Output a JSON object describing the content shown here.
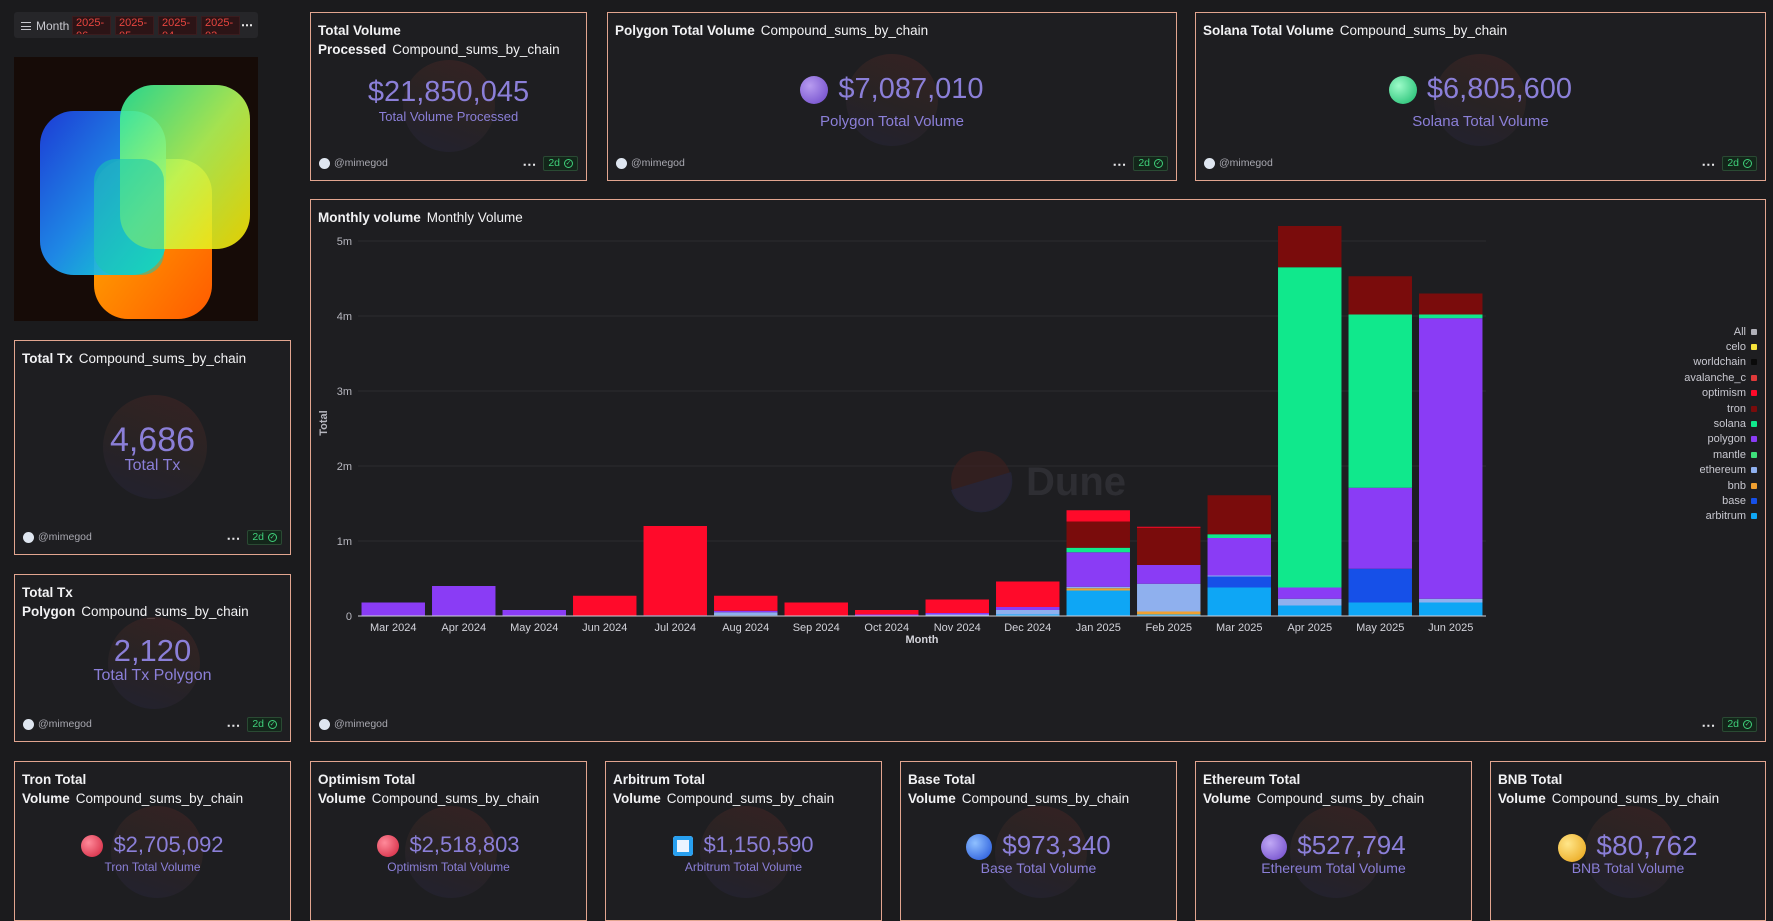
{
  "filters": {
    "label": "Month",
    "chips": [
      "2025-06",
      "2025-05",
      "2025-04",
      "2025-03"
    ],
    "more": "⋯"
  },
  "common": {
    "author": "@mimegod",
    "age": "2d",
    "dots": "⋯"
  },
  "cards": {
    "total_volume": {
      "title": "Total Volume Processed",
      "query": "Compound_sums_by_chain",
      "value": "$21,850,045",
      "label": "Total Volume Processed"
    },
    "polygon_total": {
      "title": "Polygon Total Volume",
      "query": "Compound_sums_by_chain",
      "value": "$7,087,010",
      "label": "Polygon Total Volume",
      "coin_color": "#8a6ad6"
    },
    "solana_total": {
      "title": "Solana Total Volume",
      "query": "Compound_sums_by_chain",
      "value": "$6,805,600",
      "label": "Solana Total Volume",
      "coin_color": "#29d98a"
    },
    "total_tx": {
      "title": "Total Tx",
      "query": "Compound_sums_by_chain",
      "value": "4,686",
      "label": "Total Tx"
    },
    "total_tx_polygon": {
      "title": "Total Tx Polygon",
      "query": "Compound_sums_by_chain",
      "value": "2,120",
      "label": "Total Tx Polygon"
    },
    "tron_total": {
      "title": "Tron Total Volume",
      "query": "Compound_sums_by_chain",
      "value": "$2,705,092",
      "label": "Tron Total Volume",
      "coin_color": "#e8364c"
    },
    "optimism_total": {
      "title": "Optimism Total Volume",
      "query": "Compound_sums_by_chain",
      "value": "$2,518,803",
      "label": "Optimism Total Volume",
      "coin_color": "#e8364c"
    },
    "arbitrum_total": {
      "title": "Arbitrum Total Volume",
      "query": "Compound_sums_by_chain",
      "value": "$1,150,590",
      "label": "Arbitrum Total Volume",
      "coin_color": "#28a0f0"
    },
    "base_total": {
      "title": "Base Total Volume",
      "query": "Compound_sums_by_chain",
      "value": "$973,340",
      "label": "Base Total Volume",
      "coin_color": "#2a6df4"
    },
    "ethereum_total": {
      "title": "Ethereum Total Volume",
      "query": "Compound_sums_by_chain",
      "value": "$527,794",
      "label": "Ethereum Total Volume",
      "coin_color": "#8a6ad6"
    },
    "bnb_total": {
      "title": "BNB Total Volume",
      "query": "Compound_sums_by_chain",
      "value": "$80,762",
      "label": "BNB Total Volume",
      "coin_color": "#f3ba2f"
    }
  },
  "monthly": {
    "title": "Monthly volume",
    "query": "Monthly Volume",
    "watermark": "Dune"
  },
  "chart_data": {
    "type": "bar",
    "stacked": true,
    "title": "Monthly volume",
    "xlabel": "Month",
    "ylabel": "Total",
    "ylim": [
      0,
      5000000
    ],
    "yticks": [
      "0",
      "1m",
      "2m",
      "3m",
      "4m",
      "5m"
    ],
    "legend_position": "right",
    "legend_entries": [
      "All",
      "celo",
      "worldchain",
      "avalanche_c",
      "optimism",
      "tron",
      "solana",
      "polygon",
      "mantle",
      "ethereum",
      "bnb",
      "base",
      "arbitrum"
    ],
    "legend_colors": [
      "#b0b0b8",
      "#f5e23a",
      "#0a0a0a",
      "#e03a3a",
      "#ff0a2a",
      "#7a0c0c",
      "#10e88c",
      "#8a3cf5",
      "#3ee07a",
      "#8fb0ee",
      "#f0a030",
      "#1650e8",
      "#0ea6f5"
    ],
    "categories": [
      "Mar 2024",
      "Apr 2024",
      "May 2024",
      "Jun 2024",
      "Jul 2024",
      "Aug 2024",
      "Sep 2024",
      "Oct 2024",
      "Nov 2024",
      "Dec 2024",
      "Jan 2025",
      "Feb 2025",
      "Mar 2025",
      "Apr 2025",
      "May 2025",
      "Jun 2025"
    ],
    "series": [
      {
        "name": "arbitrum",
        "color": "#0ea6f5",
        "values": [
          0,
          0,
          0,
          0,
          0,
          10000,
          0,
          0,
          10000,
          20000,
          340000,
          20000,
          380000,
          140000,
          180000,
          180000
        ]
      },
      {
        "name": "base",
        "color": "#1650e8",
        "values": [
          0,
          0,
          0,
          0,
          0,
          0,
          0,
          0,
          0,
          0,
          0,
          0,
          150000,
          0,
          450000,
          0
        ]
      },
      {
        "name": "bnb",
        "color": "#f0a030",
        "values": [
          0,
          0,
          0,
          0,
          0,
          0,
          0,
          0,
          0,
          0,
          30000,
          40000,
          0,
          0,
          0,
          0
        ]
      },
      {
        "name": "ethereum",
        "color": "#8fb0ee",
        "values": [
          0,
          0,
          0,
          0,
          0,
          40000,
          0,
          10000,
          10000,
          60000,
          20000,
          370000,
          10000,
          90000,
          0,
          50000
        ]
      },
      {
        "name": "mantle",
        "color": "#3ee07a",
        "values": [
          0,
          0,
          0,
          0,
          0,
          0,
          0,
          0,
          0,
          0,
          0,
          0,
          0,
          0,
          0,
          0
        ]
      },
      {
        "name": "polygon",
        "color": "#8a3cf5",
        "values": [
          180000,
          400000,
          80000,
          0,
          10000,
          20000,
          0,
          10000,
          20000,
          40000,
          460000,
          250000,
          500000,
          150000,
          1080000,
          3740000
        ]
      },
      {
        "name": "solana",
        "color": "#10e88c",
        "values": [
          0,
          0,
          0,
          0,
          0,
          0,
          0,
          0,
          0,
          0,
          60000,
          0,
          50000,
          4270000,
          2310000,
          50000
        ]
      },
      {
        "name": "tron",
        "color": "#7a0c0c",
        "values": [
          0,
          0,
          0,
          0,
          0,
          0,
          0,
          0,
          0,
          0,
          350000,
          500000,
          520000,
          550000,
          510000,
          280000
        ]
      },
      {
        "name": "optimism",
        "color": "#ff0a2a",
        "values": [
          0,
          0,
          0,
          270000,
          1190000,
          200000,
          180000,
          60000,
          180000,
          340000,
          150000,
          10000,
          0,
          0,
          0,
          0
        ]
      },
      {
        "name": "avalanche_c",
        "color": "#e03a3a",
        "values": [
          0,
          0,
          0,
          0,
          0,
          0,
          0,
          0,
          0,
          0,
          0,
          0,
          0,
          0,
          0,
          0
        ]
      },
      {
        "name": "worldchain",
        "color": "#0a0a0a",
        "values": [
          0,
          0,
          0,
          0,
          0,
          0,
          0,
          0,
          0,
          0,
          0,
          0,
          0,
          0,
          0,
          0
        ]
      },
      {
        "name": "celo",
        "color": "#f5e23a",
        "values": [
          0,
          0,
          0,
          0,
          0,
          0,
          0,
          0,
          0,
          0,
          0,
          0,
          0,
          0,
          0,
          0
        ]
      }
    ]
  }
}
